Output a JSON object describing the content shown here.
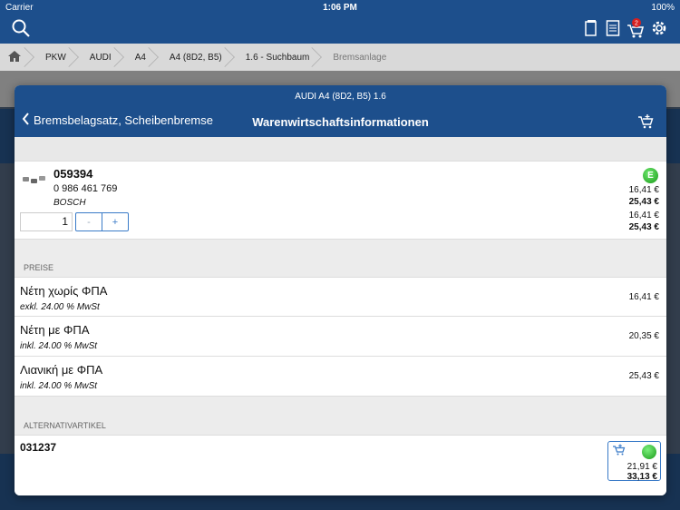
{
  "statusbar": {
    "carrier": "Carrier",
    "time": "1:06 PM",
    "battery": "100%"
  },
  "topbar": {
    "cart_count": "2",
    "icons": [
      "search-icon",
      "document-icon",
      "list-icon",
      "cart-icon",
      "gear-icon"
    ]
  },
  "breadcrumb": [
    "PKW",
    "AUDI",
    "A4",
    "A4 (8D2, B5)",
    "1.6 - Suchbaum",
    "Bremsanlage"
  ],
  "modal": {
    "subtitle": "AUDI A4 (8D2, B5) 1.6",
    "back_label": "Bremsbelagsatz, Scheibenbremse",
    "title": "Warenwirtschaftsinformationen"
  },
  "article": {
    "number": "059394",
    "ean": "0 986 461 769",
    "brand": "BOSCH",
    "quantity": "1",
    "minus": "-",
    "plus": "+",
    "badge": "E",
    "prices": [
      "16,41 €",
      "25,43 €",
      "16,41 €",
      "25,43 €"
    ]
  },
  "preise": {
    "header": "PREISE",
    "rows": [
      {
        "label": "Νέτη χωρίς ΦΠΑ",
        "note": "exkl. 24.00 % MwSt",
        "value": "16,41 €"
      },
      {
        "label": "Νέτη με ΦΠΑ",
        "note": "inkl. 24.00 % MwSt",
        "value": "20,35 €"
      },
      {
        "label": "Λιανική με ΦΠΑ",
        "note": "inkl. 24.00 % MwSt",
        "value": "25,43 €"
      }
    ]
  },
  "alternatives": {
    "header": "ALTERNATIVARTIKEL",
    "items": [
      {
        "number": "031237",
        "price_net": "21,91 €",
        "price_gross": "33,13 €"
      }
    ]
  },
  "colors": {
    "nav": "#1d4f8c",
    "accent": "#3a7bc8",
    "available": "#22aa22"
  }
}
